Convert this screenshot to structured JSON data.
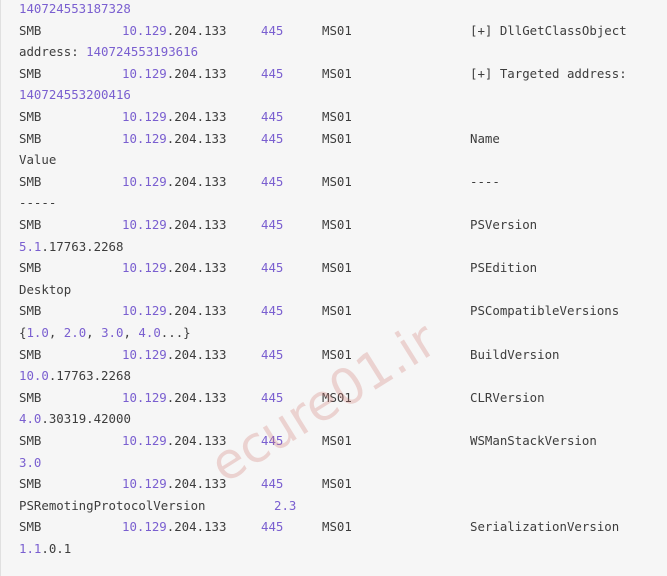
{
  "rows": [
    {
      "type": "wrap",
      "head": "140724553187328",
      "tail": "",
      "head_class": "purple"
    },
    {
      "type": "cols",
      "proto": "SMB",
      "ip_a": "10.129",
      "ip_b": ".204.133",
      "port": "445",
      "host": "MS01",
      "msg": "[+] DllGetClassObject"
    },
    {
      "type": "wrap",
      "head": "address: ",
      "tail": "140724553193616",
      "head_class": "",
      "tail_class": "purple"
    },
    {
      "type": "cols",
      "proto": "SMB",
      "ip_a": "10.129",
      "ip_b": ".204.133",
      "port": "445",
      "host": "MS01",
      "msg": "[+] Targeted address:"
    },
    {
      "type": "wrap",
      "head": "140724553200416",
      "tail": "",
      "head_class": "purple"
    },
    {
      "type": "cols",
      "proto": "SMB",
      "ip_a": "10.129",
      "ip_b": ".204.133",
      "port": "445",
      "host": "MS01",
      "msg": ""
    },
    {
      "type": "cols",
      "proto": "SMB",
      "ip_a": "10.129",
      "ip_b": ".204.133",
      "port": "445",
      "host": "MS01",
      "msg": "Name"
    },
    {
      "type": "wrap",
      "head": "Value",
      "tail": "",
      "head_class": ""
    },
    {
      "type": "cols",
      "proto": "SMB",
      "ip_a": "10.129",
      "ip_b": ".204.133",
      "port": "445",
      "host": "MS01",
      "msg": "----"
    },
    {
      "type": "wrap",
      "head": "-----",
      "tail": "",
      "head_class": ""
    },
    {
      "type": "cols",
      "proto": "SMB",
      "ip_a": "10.129",
      "ip_b": ".204.133",
      "port": "445",
      "host": "MS01",
      "msg": "PSVersion"
    },
    {
      "type": "wrap",
      "head": "5.1",
      "tail": ".17763.2268",
      "head_class": "purple",
      "tail_class": ""
    },
    {
      "type": "cols",
      "proto": "SMB",
      "ip_a": "10.129",
      "ip_b": ".204.133",
      "port": "445",
      "host": "MS01",
      "msg": "PSEdition"
    },
    {
      "type": "wrap",
      "head": "Desktop",
      "tail": "",
      "head_class": ""
    },
    {
      "type": "cols",
      "proto": "SMB",
      "ip_a": "10.129",
      "ip_b": ".204.133",
      "port": "445",
      "host": "MS01",
      "msg": "PSCompatibleVersions"
    },
    {
      "type": "versions",
      "items": [
        "{",
        "1.0",
        ", ",
        "2.0",
        ", ",
        "3.0",
        ", ",
        "4.0",
        "...}"
      ]
    },
    {
      "type": "cols",
      "proto": "SMB",
      "ip_a": "10.129",
      "ip_b": ".204.133",
      "port": "445",
      "host": "MS01",
      "msg": "BuildVersion"
    },
    {
      "type": "wrap",
      "head": "10.0",
      "tail": ".17763.2268",
      "head_class": "purple",
      "tail_class": ""
    },
    {
      "type": "cols",
      "proto": "SMB",
      "ip_a": "10.129",
      "ip_b": ".204.133",
      "port": "445",
      "host": "MS01",
      "msg": "CLRVersion"
    },
    {
      "type": "wrap",
      "head": "4.0",
      "tail": ".30319.42000",
      "head_class": "purple",
      "tail_class": ""
    },
    {
      "type": "cols",
      "proto": "SMB",
      "ip_a": "10.129",
      "ip_b": ".204.133",
      "port": "445",
      "host": "MS01",
      "msg": "WSManStackVersion"
    },
    {
      "type": "wrap",
      "head": "3.0",
      "tail": "",
      "head_class": "purple"
    },
    {
      "type": "cols",
      "proto": "SMB",
      "ip_a": "10.129",
      "ip_b": ".204.133",
      "port": "445",
      "host": "MS01",
      "msg": ""
    },
    {
      "type": "pair",
      "head": "PSRemotingProtocolVersion",
      "tail": "2.3"
    },
    {
      "type": "cols",
      "proto": "SMB",
      "ip_a": "10.129",
      "ip_b": ".204.133",
      "port": "445",
      "host": "MS01",
      "msg": "SerializationVersion"
    },
    {
      "type": "wrap",
      "head": "1.1",
      "tail": ".0.1",
      "head_class": "purple",
      "tail_class": ""
    }
  ],
  "colors": {
    "background": "#f6f6f6",
    "text": "#3d3d3d",
    "accent": "#7a5fd0"
  },
  "watermark": "ecure01.ir"
}
